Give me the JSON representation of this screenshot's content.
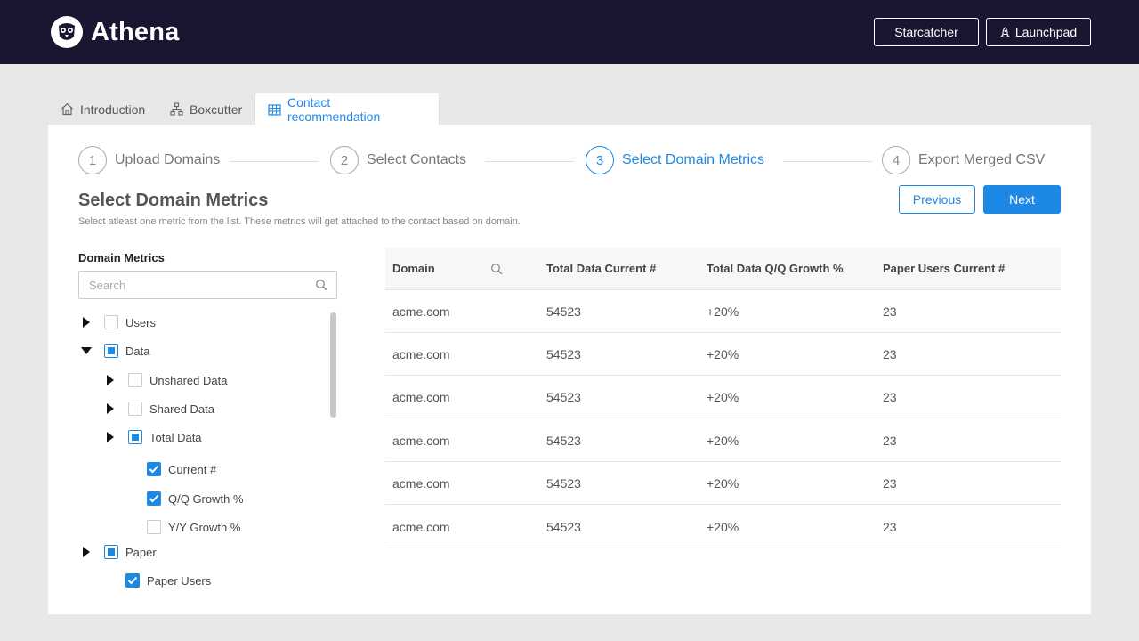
{
  "header": {
    "brand": "Athena",
    "buttons": {
      "starcatcher": "Starcatcher",
      "launchpad": "Launchpad"
    }
  },
  "tabs": [
    {
      "label": "Introduction",
      "icon": "home-icon"
    },
    {
      "label": "Boxcutter",
      "icon": "sitemap-icon"
    },
    {
      "label": "Contact recommendation",
      "icon": "table-icon",
      "active": true
    }
  ],
  "stepper": [
    {
      "num": "1",
      "label": "Upload Domains"
    },
    {
      "num": "2",
      "label": "Select Contacts"
    },
    {
      "num": "3",
      "label": "Select Domain Metrics",
      "active": true
    },
    {
      "num": "4",
      "label": "Export Merged CSV"
    }
  ],
  "page": {
    "title": "Select Domain Metrics",
    "subtitle": "Select atleast one metric from the list. These metrics will get attached to the contact based on domain.",
    "previous": "Previous",
    "next": "Next"
  },
  "tree": {
    "title": "Domain Metrics",
    "search_placeholder": "Search",
    "nodes": [
      {
        "label": "Users",
        "state": "unchecked",
        "expand": "collapsed"
      },
      {
        "label": "Data",
        "state": "partial",
        "expand": "expanded"
      },
      {
        "label": "Unshared Data",
        "state": "unchecked",
        "expand": "collapsed"
      },
      {
        "label": "Shared Data",
        "state": "unchecked",
        "expand": "collapsed"
      },
      {
        "label": "Total Data",
        "state": "partial",
        "expand": "collapsed"
      },
      {
        "label": "Current #",
        "state": "checked"
      },
      {
        "label": "Q/Q Growth %",
        "state": "checked"
      },
      {
        "label": "Y/Y Growth %",
        "state": "unchecked"
      },
      {
        "label": "Paper",
        "state": "partial",
        "expand": "collapsed"
      },
      {
        "label": "Paper Users",
        "state": "checked"
      }
    ]
  },
  "table": {
    "headers": [
      "Domain",
      "Total Data Current #",
      "Total Data Q/Q Growth %",
      "Paper Users Current #"
    ],
    "rows": [
      [
        "acme.com",
        "54523",
        "+20%",
        "23"
      ],
      [
        "acme.com",
        "54523",
        "+20%",
        "23"
      ],
      [
        "acme.com",
        "54523",
        "+20%",
        "23"
      ],
      [
        "acme.com",
        "54523",
        "+20%",
        "23"
      ],
      [
        "acme.com",
        "54523",
        "+20%",
        "23"
      ],
      [
        "acme.com",
        "54523",
        "+20%",
        "23"
      ]
    ]
  },
  "colors": {
    "accent": "#1e88e5",
    "header_bg": "#1a1530"
  }
}
